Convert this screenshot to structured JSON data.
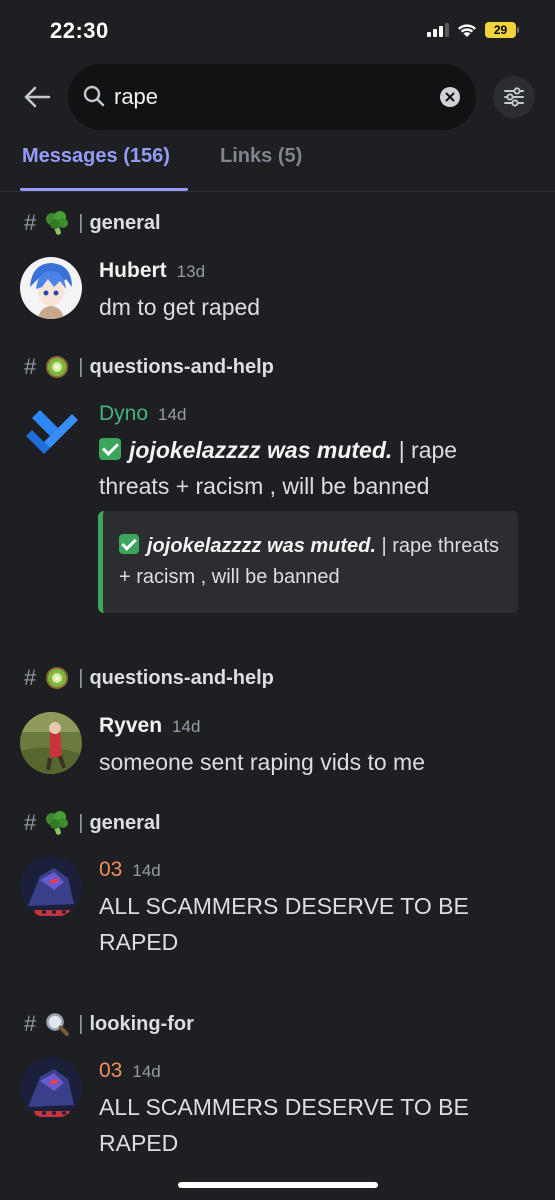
{
  "status_bar": {
    "time": "22:30",
    "battery": "29"
  },
  "search": {
    "value": "rape"
  },
  "tabs": [
    {
      "label": "Messages",
      "count": "(156)"
    },
    {
      "label": "Links",
      "count": "(5)"
    }
  ],
  "results": [
    {
      "channel": {
        "hash": "#",
        "emoji": "broccoli",
        "sep": "|",
        "name": "general"
      },
      "author": "Hubert",
      "time": "13d",
      "text": "dm to get raped"
    },
    {
      "channel": {
        "hash": "#",
        "emoji": "kiwi",
        "sep": "|",
        "name": "questions-and-help"
      },
      "author": "Dyno",
      "time": "14d",
      "bold_text": "jojokelazzzz was muted.",
      "rest_text": "| rape threats + racism , will be banned",
      "embed": {
        "bold_text": "jojokelazzzz was muted.",
        "rest_text": "| rape threats + racism , will be banned"
      }
    },
    {
      "channel": {
        "hash": "#",
        "emoji": "kiwi",
        "sep": "|",
        "name": "questions-and-help"
      },
      "author": "Ryven",
      "time": "14d",
      "text": "someone sent raping vids to me"
    },
    {
      "channel": {
        "hash": "#",
        "emoji": "broccoli",
        "sep": "|",
        "name": "general"
      },
      "author": "03",
      "time": "14d",
      "text": "ALL SCAMMERS DESERVE TO BE RAPED"
    },
    {
      "channel": {
        "hash": "#",
        "emoji": "magnifying-glass",
        "sep": "|",
        "name": "looking-for"
      },
      "author": "03",
      "time": "14d",
      "text": "ALL SCAMMERS DESERVE TO BE RAPED"
    }
  ],
  "colors": {
    "background": "#1e1f22",
    "accent": "#949cf7",
    "bot_name": "#43b581",
    "user_03": "#f0915c",
    "embed_border": "#3ba55c"
  }
}
